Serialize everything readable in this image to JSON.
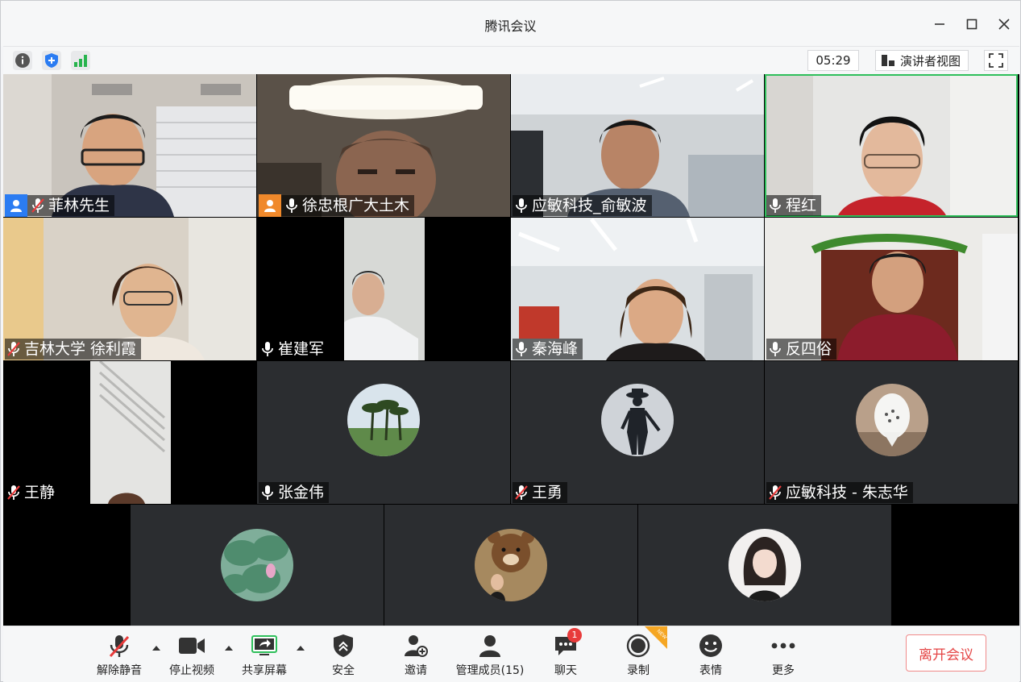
{
  "app": {
    "title": "腾讯会议"
  },
  "status": {
    "timer": "05:29",
    "view_label": "演讲者视图"
  },
  "participants": [
    {
      "name": "菲林先生"
    },
    {
      "name": "徐忠根广大土木"
    },
    {
      "name": "应敏科技_俞敏波"
    },
    {
      "name": "程红"
    },
    {
      "name": "吉林大学 徐利霞"
    },
    {
      "name": "崔建军"
    },
    {
      "name": "秦海峰"
    },
    {
      "name": "反四俗"
    },
    {
      "name": "王静"
    },
    {
      "name": "张金伟"
    },
    {
      "name": "王勇"
    },
    {
      "name": "应敏科技 - 朱志华"
    }
  ],
  "toolbar": {
    "unmute": "解除静音",
    "stop_video": "停止视频",
    "share_screen": "共享屏幕",
    "security": "安全",
    "invite": "邀请",
    "manage_members": "管理成员(15)",
    "chat": "聊天",
    "chat_badge": "1",
    "record": "录制",
    "record_tag": "NEW",
    "reactions": "表情",
    "more": "更多",
    "leave": "离开会议"
  },
  "colors": {
    "leave_text": "#e54545",
    "active_border": "#2fbf5b",
    "host_badge": "#2b7cf2",
    "cohost_badge": "#f0892b"
  }
}
